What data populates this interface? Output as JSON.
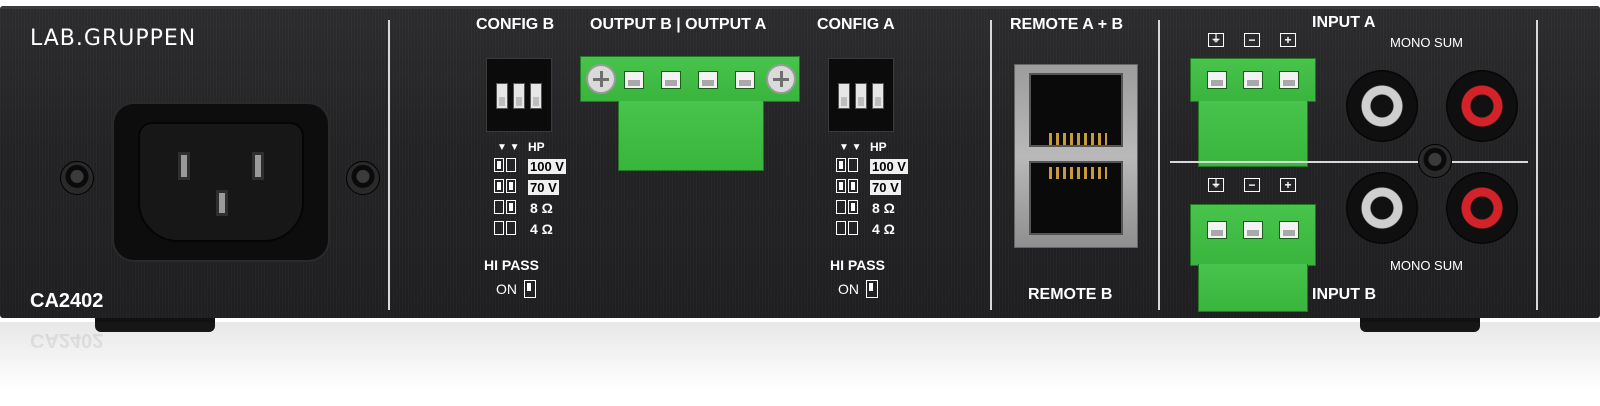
{
  "brand": "LAB.GRUPPEN",
  "model": "CA2402",
  "config_b": {
    "title": "CONFIG B",
    "hp_label": "HP",
    "hi_pass_label": "HI PASS",
    "on_label": "ON",
    "options": [
      "100 V",
      "70 V",
      "8 Ω",
      "4 Ω"
    ]
  },
  "config_a": {
    "title": "CONFIG A",
    "hp_label": "HP",
    "hi_pass_label": "HI PASS",
    "on_label": "ON",
    "options": [
      "100 V",
      "70 V",
      "8 Ω",
      "4 Ω"
    ]
  },
  "outputs_title": "OUTPUT B | OUTPUT A",
  "remote": {
    "top_label": "REMOTE A + B",
    "bottom_label": "REMOTE B"
  },
  "input_a": {
    "title": "INPUT A",
    "mono_sum": "MONO SUM"
  },
  "input_b": {
    "title": "INPUT B",
    "mono_sum": "MONO SUM"
  },
  "reflection_text": "CA2402"
}
